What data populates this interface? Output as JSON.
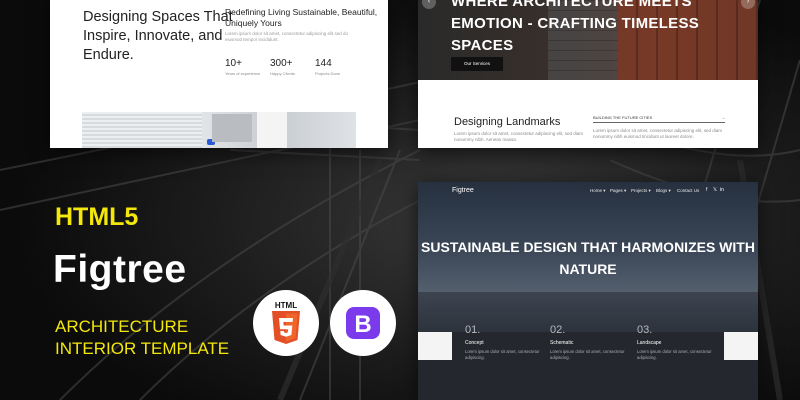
{
  "branding": {
    "tag": "HTML5",
    "product": "Figtree",
    "tagline": [
      "ARCHITECTURE",
      "INTERIOR TEMPLATE"
    ],
    "accent_color": "#f4e80b",
    "html5_logo_text": "HTML",
    "bootstrap_logo_text": "B"
  },
  "card1": {
    "heading": "Designing Spaces That Inspire, Innovate, and Endure.",
    "subheading": "Redefining Living Sustainable, Beautiful, Uniquely Yours",
    "body": "Lorem ipsum dolor sit amet, consectetur adipiscing elit sed do eiusmod tempor incididunt.",
    "stats": [
      {
        "value": "10+",
        "label": "Years of experience"
      },
      {
        "value": "300+",
        "label": "Happy Clients"
      },
      {
        "value": "144",
        "label": "Projects Done"
      }
    ]
  },
  "card2": {
    "headline": "WHERE ARCHITECTURE MEETS EMOTION - CRAFTING TIMELESS SPACES",
    "services_button": "Our Services",
    "prev_icon": "chevron-left-icon",
    "next_icon": "chevron-right-icon",
    "section_title": "Designing Landmarks",
    "section_body": "Lorem ipsum dolor sit amet, consectetur adipiscing elit, sed diam nonummy nibh. Aenean massa.",
    "future_label": "BUILDING THE FUTURE CITIES",
    "future_body": "Lorem ipsum dolor sit amet, consectetur adipiscing elit, sed diam nonummy nibh euismod tincidunt ut laoreet dolore."
  },
  "card3": {
    "brand": "Figtree",
    "nav": [
      "Home ▾",
      "Pages ▾",
      "Projects ▾",
      "Blogs ▾",
      "Contact Us"
    ],
    "social": [
      "f",
      "𝕏",
      "in"
    ],
    "hero_title": "SUSTAINABLE DESIGN THAT HARMONIZES WITH NATURE",
    "steps": [
      {
        "num": "01.",
        "title": "Concept",
        "text": "Lorem ipsum dolor sit amet, consectetur adipiscing."
      },
      {
        "num": "02.",
        "title": "Schematic",
        "text": "Lorem ipsum dolor sit amet, consectetur adipiscing."
      },
      {
        "num": "03.",
        "title": "Landscape",
        "text": "Lorem ipsum dolor sit amet, consectetur adipiscing."
      }
    ]
  }
}
